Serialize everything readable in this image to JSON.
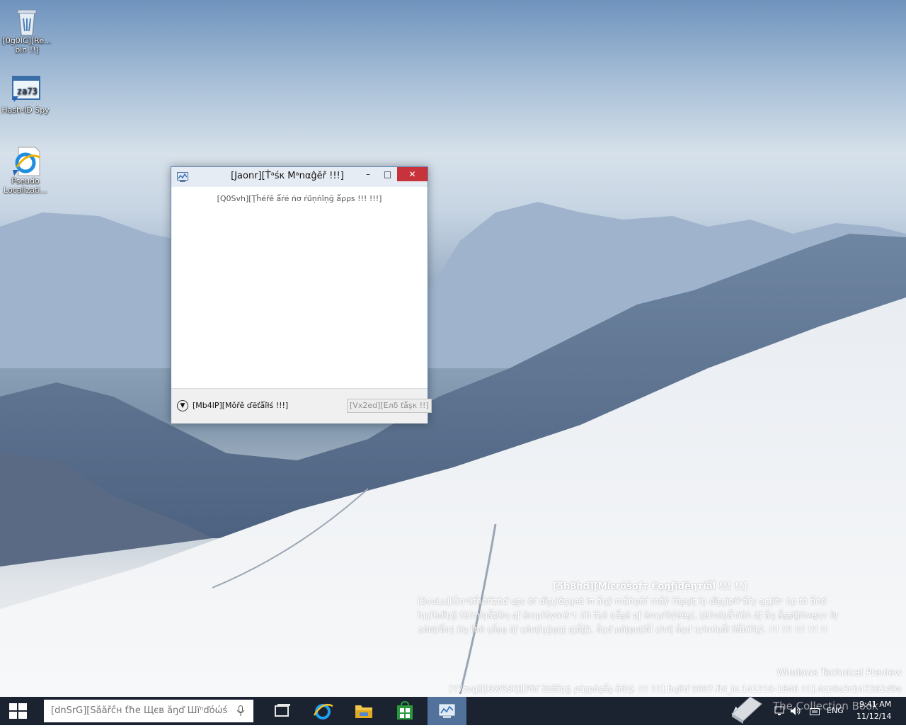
{
  "desktop": {
    "icons": [
      {
        "label_line1": "[0g0IC][Re...",
        "label_line2": "bin !!]"
      },
      {
        "label_line1": "Hash-ID Spy",
        "label_line2": ""
      },
      {
        "label_line1": "Pseudo",
        "label_line2": "Localizati..."
      }
    ]
  },
  "window": {
    "title": "[Jaonr][Ṫᵃśκ Mᵃnαĝěř !!!]",
    "minimize_glyph": "–",
    "maximize_glyph": "□",
    "close_glyph": "✕",
    "empty_message": "[Q0Svh][Ţĥéřě ǻŕé ńσ ŕűņńîņğ ǻρρѕ !!! !!!]",
    "more_details": "[Mb4lP][Mǒřě ɗёťǻǐłś !!!]",
    "end_task": "[Vx2ed][Eлδ ťǻşκ !!]"
  },
  "watermark": {
    "heading": "[5h8hd][Micrŏšoƒτ €ǫŋƒïďěητïǻĺ !!! !!]",
    "line1": "[SceLu][Ŭnᵃũťĥōřïżēď ųşє ōŕ ďïşçłőşųяē ïπ ǻηŷ mǻńņēř mǻý řēşųłţ ïņ ďïşçïpľïⁿǻŕy ąçţïōⁿ ύρ ťό ǻńđ",
    "line2": "ïηçľūďïņğ ťēŕmïņǻţïŏη øƒ ēmρľόγmēⁿτ (ïń ťђē ¢ǻşē øƒ ēmρľŏŷēēş), ţēřmïņǻτïőń ǿƒ ǻŋ ǻşşïğñмęητ θŗ",
    "line3": "¢ǿπţŕǻ¢ţ (ïŋ ťĥē çǻşę ǿƒ çǿņţïŋğęŋţ şţǻƒƒ), ǻŋď ρǿţęņţïǻĺ ¢ïvïļ ǻŋď ¢ŗïmïņǻł łïǻƀïľïţŷ. !!! !!! !!! !!! !!",
    "preview": "Windows Technical Preview",
    "build": "[Y7zvg][[6W58Q][Fōŕ ťéśťïņġ ρüŗρóşǻş ŏñŀý. !!! !!!] ɓųïľď 9907.fbl_ie.141210-1846 !!!].4ce9a3cb47262d9e"
  },
  "taskbar": {
    "search_placeholder": "[dnSrG][Šǻǻřĉн ťħе Щєв ǻŋď Шïⁿďόώś",
    "tray_language": "ENG",
    "time": "9:41 AM",
    "date": "11/12/14",
    "collection_book": "The Collection Book"
  },
  "colors": {
    "accent": "#52729c",
    "close": "#c7323b",
    "taskbar": "#1c2330"
  }
}
